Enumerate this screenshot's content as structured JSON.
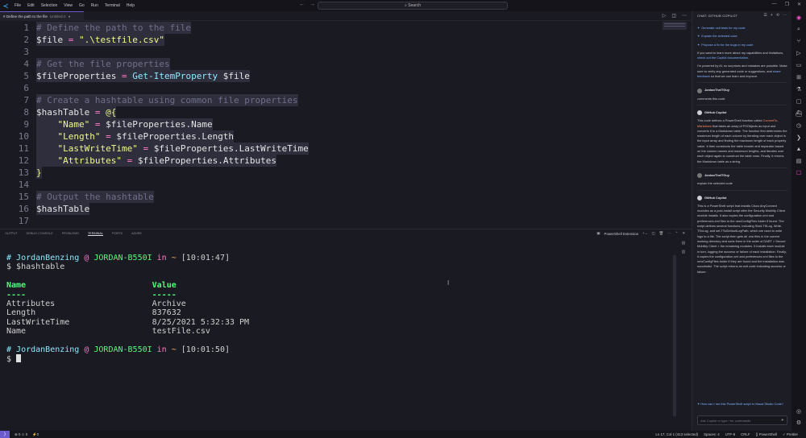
{
  "titlebar": {
    "menu": [
      "File",
      "Edit",
      "Selection",
      "View",
      "Go",
      "Run",
      "Terminal",
      "Help"
    ],
    "search": "Search",
    "window_controls": [
      "—",
      "❐",
      "✕"
    ]
  },
  "tab": {
    "label": "# Define the path to the file",
    "hint": "Untitled-2",
    "close": "●"
  },
  "editor": {
    "lines": [
      {
        "n": "1",
        "comment": "# Define the path to the file"
      },
      {
        "n": "2",
        "var": "$file",
        "op": " = ",
        "str": "\".\\testfile.csv\""
      },
      {
        "n": "3"
      },
      {
        "n": "4",
        "comment": "# Get the file properties"
      },
      {
        "n": "5",
        "var": "$fileProperties",
        "op": " = ",
        "cmd": "Get-ItemProperty",
        "arg": " $file"
      },
      {
        "n": "6"
      },
      {
        "n": "7",
        "comment": "# Create a hashtable using common file properties"
      },
      {
        "n": "8",
        "var": "$hashTable",
        "op": " = ",
        "brk": "@{"
      },
      {
        "n": "9",
        "indent": "    ",
        "str": "\"Name\"",
        "op": " = ",
        "arg": "$fileProperties.Name"
      },
      {
        "n": "10",
        "indent": "    ",
        "str": "\"Length\"",
        "op": " = ",
        "arg": "$fileProperties.Length"
      },
      {
        "n": "11",
        "indent": "    ",
        "str": "\"LastWriteTime\"",
        "op": " = ",
        "arg": "$fileProperties.LastWriteTime"
      },
      {
        "n": "12",
        "indent": "    ",
        "str": "\"Attributes\"",
        "op": " = ",
        "arg": "$fileProperties.Attributes"
      },
      {
        "n": "13",
        "brk": "}"
      },
      {
        "n": "14"
      },
      {
        "n": "15",
        "comment": "# Output the hashtable"
      },
      {
        "n": "16",
        "var": "$hashTable"
      },
      {
        "n": "17"
      }
    ]
  },
  "panel": {
    "tabs": [
      "OUTPUT",
      "DEBUG CONSOLE",
      "PROBLEMS",
      "TERMINAL",
      "PORTS",
      "AZURE"
    ],
    "active_tab": "TERMINAL",
    "terminal_name": "PowerShell Extension",
    "terminal": {
      "prompt1": {
        "hash": "# ",
        "user": "JordanBenzing",
        "at": " @ ",
        "host": "JORDAN-B550I",
        "in": " in ",
        "path": "~",
        "time": " [10:01:47]"
      },
      "cmd1": "$hashtable",
      "col_name": "Name",
      "col_value": "Value",
      "dashes": "----",
      "dashes2": "-----",
      "rows": [
        {
          "name": "Attributes",
          "value": "Archive"
        },
        {
          "name": "Length",
          "value": "837632"
        },
        {
          "name": "LastWriteTime",
          "value": "8/25/2021 5:32:33 PM"
        },
        {
          "name": "Name",
          "value": "testFile.csv"
        }
      ],
      "prompt2": {
        "hash": "# ",
        "user": "JordanBenzing",
        "at": " @ ",
        "host": "JORDAN-B550I",
        "in": " in ",
        "path": "~",
        "time": " [10:01:50]"
      },
      "dollar": "$ "
    }
  },
  "chat": {
    "title": "CHAT: GITHUB COPILOT",
    "suggestions": [
      "Generate unit tests for my code",
      "Explain the selected code",
      "Propose a fix for the bugs in my code"
    ],
    "intro1": "If you want to learn more about my capabilities and limitations,",
    "intro1_link": "check out the Copilot documentation",
    "intro2": "I'm powered by AI, so surprises and mistakes are possible. Make sure to verify any generated code or suggestions, and",
    "intro2_link": "share feedback",
    "intro2_tail": "so that we can learn and improve.",
    "user_name": "JordanTheITGuy",
    "bot_name": "GitHub Copilot",
    "msg1": "comments this code",
    "reply1_a": "This code defines a PowerShell function called",
    "reply1_code": "ConvertTo-Markdown",
    "reply1_b": "that takes an array of PSObjects as input and converts it to a Markdown table. The function first determines the maximum length of each column by iterating over each object in the input array and finding the maximum length of each property value. It then constructs the table header and separator based on the column names and maximum lengths, and iterates over each object again to construct the table rows. Finally, it returns the Markdown table as a string.",
    "msg2": "explain the selected code",
    "reply2": "This is a PowerShell script that installs Cisco AnyConnect modules as a post-install script after the Security Mobility Client module installs. It also copies the configuration.xml and preferences.xml files to the newConfigFiles folder if found. The script defines several functions, including Start-TSLog, Write-TSxLog, and set-TSxDefaultLogPath, which are used to write logs to a file. The script then gets all .msi files in the current working directory and sorts them in the order of DART > Secure Mobility Client > the remaining modules. It installs each module in turn, logging the success or failure of each installation. Finally, it copies the configuration.xml and preferences.xml files to the newConfigFiles folder if they are found and the installation was successful. The script returns an exit code indicating success or failure.",
    "followup": "How can I run this PowerShell script in Visual Studio Code?",
    "input_placeholder": "Ask Copilot or type / for commands"
  },
  "status": {
    "left": [
      "⊗ 0 ⚠ 0",
      "⚡0"
    ],
    "right": [
      "Ln 17, Col 1 (413 selected)",
      "Spaces: 4",
      "UTF-8",
      "CRLF",
      "{} PowerShell",
      "✓ Prettier"
    ]
  }
}
